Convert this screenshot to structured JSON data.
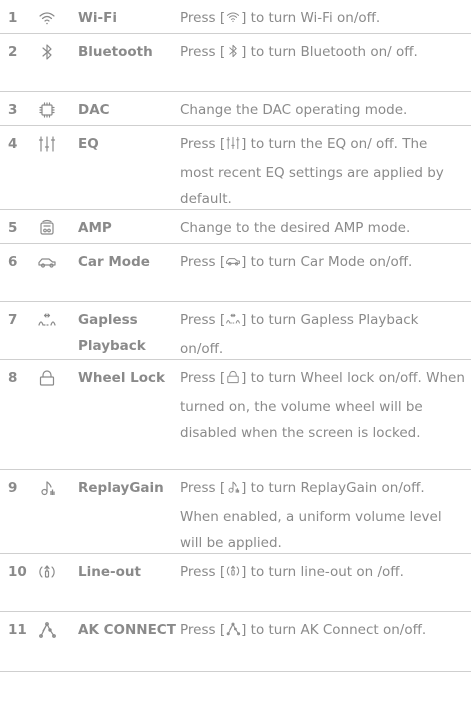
{
  "rows": [
    {
      "num": "1",
      "name": "Wi-Fi",
      "icon": "wifi-icon",
      "pre": "Press [",
      "post": "] to turn Wi-Fi on/off.",
      "h": 34
    },
    {
      "num": "2",
      "name": "Bluetooth",
      "icon": "bluetooth-icon",
      "pre": "Press [",
      "post": "] to turn Bluetooth on/ off.",
      "h": 58
    },
    {
      "num": "3",
      "name": "DAC",
      "icon": "chip-icon",
      "pre": "",
      "post": "Change the DAC operating mode.",
      "h": 34
    },
    {
      "num": "4",
      "name": "EQ",
      "icon": "equalizer-icon",
      "pre": "Press [",
      "post": "] to turn the EQ on/ off. The most recent EQ settings are applied by default.",
      "h": 84
    },
    {
      "num": "5",
      "name": "AMP",
      "icon": "amp-icon",
      "pre": "",
      "post": "Change to the desired AMP mode.",
      "h": 34
    },
    {
      "num": "6",
      "name": "Car Mode",
      "icon": "car-icon",
      "pre": "Press [",
      "post": "] to turn Car Mode on/off.",
      "h": 58
    },
    {
      "num": "7",
      "name": "Gapless Playback",
      "icon": "gapless-icon",
      "pre": "Press [",
      "post": "] to turn Gapless Playback on/off.",
      "h": 58
    },
    {
      "num": "8",
      "name": "Wheel Lock",
      "icon": "lock-icon",
      "pre": "Press [",
      "post": "] to turn Wheel lock on/off. When turned on, the volume wheel will be disabled when the screen is locked.",
      "h": 110
    },
    {
      "num": "9",
      "name": "ReplayGain",
      "icon": "replaygain-icon",
      "pre": "Press [",
      "post": "] to turn ReplayGain on/off. When enabled, a uniform volume level will be applied.",
      "h": 84
    },
    {
      "num": "10",
      "name": "Line-out",
      "icon": "line-out-icon",
      "pre": "Press [",
      "post": "] to turn line-out on /off.",
      "h": 58
    },
    {
      "num": "11",
      "name": "AK CONNECT",
      "icon": "ak-connect-icon",
      "pre": "Press [",
      "post": "] to turn AK Connect on/off.",
      "h": 60
    }
  ]
}
